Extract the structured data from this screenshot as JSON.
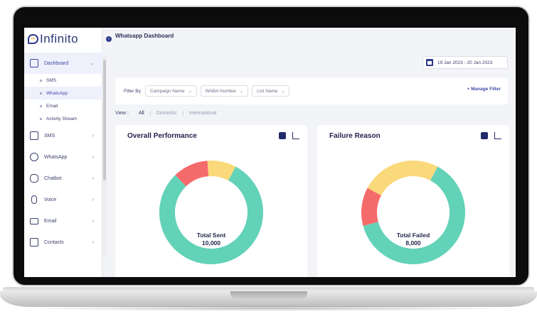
{
  "app": {
    "logo_text": "Infinito"
  },
  "header": {
    "title": "Whatsapp Dashboard",
    "date_range": "19 Jan 2023 - 20 Jan 2023"
  },
  "sidebar": {
    "items": [
      {
        "label": "Dashboard",
        "icon": "dashboard-grid-icon",
        "active": true,
        "children": [
          {
            "label": "SMS"
          },
          {
            "label": "WhatsApp",
            "active": true
          },
          {
            "label": "Email"
          },
          {
            "label": "Activity Stream"
          }
        ]
      },
      {
        "label": "SMS",
        "icon": "message-icon"
      },
      {
        "label": "WhatsApp",
        "icon": "whatsapp-icon"
      },
      {
        "label": "Chatbot",
        "icon": "bot-icon"
      },
      {
        "label": "Voice",
        "icon": "microphone-icon"
      },
      {
        "label": "Email",
        "icon": "mail-icon"
      },
      {
        "label": "Contacts",
        "icon": "contacts-icon"
      }
    ]
  },
  "filters": {
    "label": "Filter By",
    "dropdowns": [
      "Campaign Name",
      "WABA Number",
      "List Name"
    ],
    "manage_label": "Manage Filter"
  },
  "view": {
    "label": "View :",
    "options": [
      "All",
      "Domestic",
      "International"
    ],
    "selected": "All"
  },
  "cards": [
    {
      "title": "Overall Performance",
      "center_label": "Total Sent",
      "center_value": "10,000",
      "segments": [
        {
          "color": "#62d2b8",
          "fraction": 0.8
        },
        {
          "color": "#f56b6b",
          "fraction": 0.11
        },
        {
          "color": "#fad97a",
          "fraction": 0.09
        }
      ]
    },
    {
      "title": "Failure Reason",
      "center_label": "Total Failed",
      "center_value": "8,000",
      "segments": [
        {
          "color": "#62d2b8",
          "fraction": 0.63
        },
        {
          "color": "#f56b6b",
          "fraction": 0.12
        },
        {
          "color": "#fad97a",
          "fraction": 0.25
        }
      ]
    }
  ],
  "colors": {
    "accent": "#2e3a8c",
    "active_bg": "#eef0fb",
    "teal": "#62d2b8",
    "red": "#f56b6b",
    "yellow": "#fad97a"
  }
}
